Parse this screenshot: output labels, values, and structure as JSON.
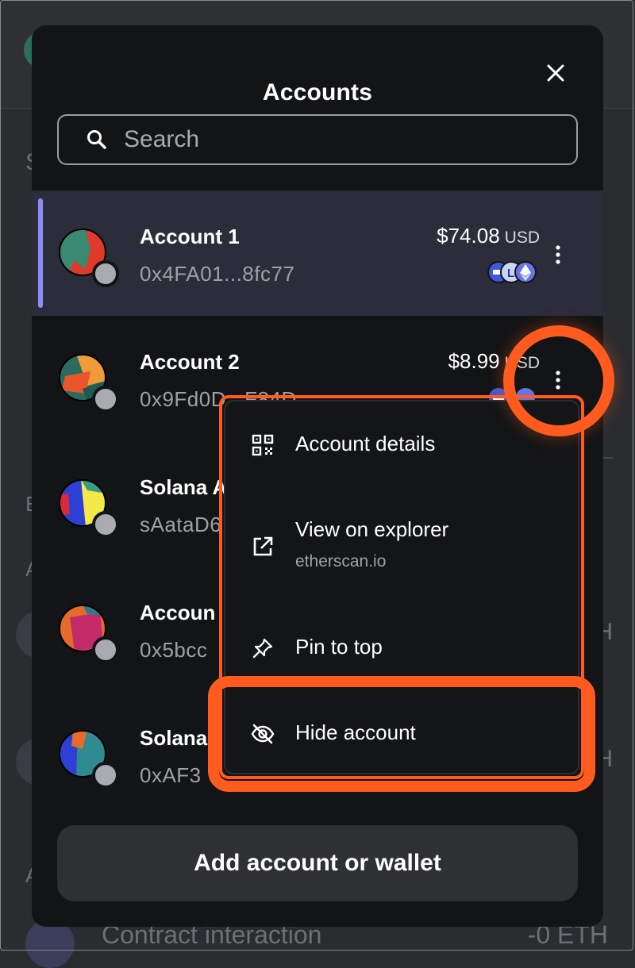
{
  "modal": {
    "title": "Accounts",
    "search_placeholder": "Search",
    "add_button_label": "Add account or wallet"
  },
  "accounts": [
    {
      "name": "Account 1",
      "address": "0x4FA01...8fc77",
      "balance": "$74.08",
      "currency": "USD",
      "selected": true
    },
    {
      "name": "Account 2",
      "address": "0x9Fd0D...F84D",
      "balance": "$8.99",
      "currency": "USD",
      "selected": false
    },
    {
      "name": "Solana A",
      "address": "sAataD6",
      "balance": "",
      "currency": "",
      "selected": false
    },
    {
      "name": "Accoun",
      "address": "0x5bcc",
      "balance": "",
      "currency": "",
      "selected": false
    },
    {
      "name": "Solana",
      "address": "0xAF3",
      "balance": "",
      "currency": "",
      "selected": false
    }
  ],
  "context_menu": {
    "items": [
      {
        "label": "Account details",
        "icon": "qr-code-icon"
      },
      {
        "label": "View on explorer",
        "sublabel": "etherscan.io",
        "icon": "external-link-icon"
      },
      {
        "label": "Pin to top",
        "icon": "pin-icon"
      },
      {
        "label": "Hide account",
        "icon": "eye-off-icon"
      }
    ]
  },
  "background": {
    "activity_label": "Contract interaction",
    "activity_amount": "-0 ETH"
  },
  "colors": {
    "accent_selected": "#8c8df6",
    "highlight": "#ff5b1f",
    "modal_bg": "#131416"
  }
}
